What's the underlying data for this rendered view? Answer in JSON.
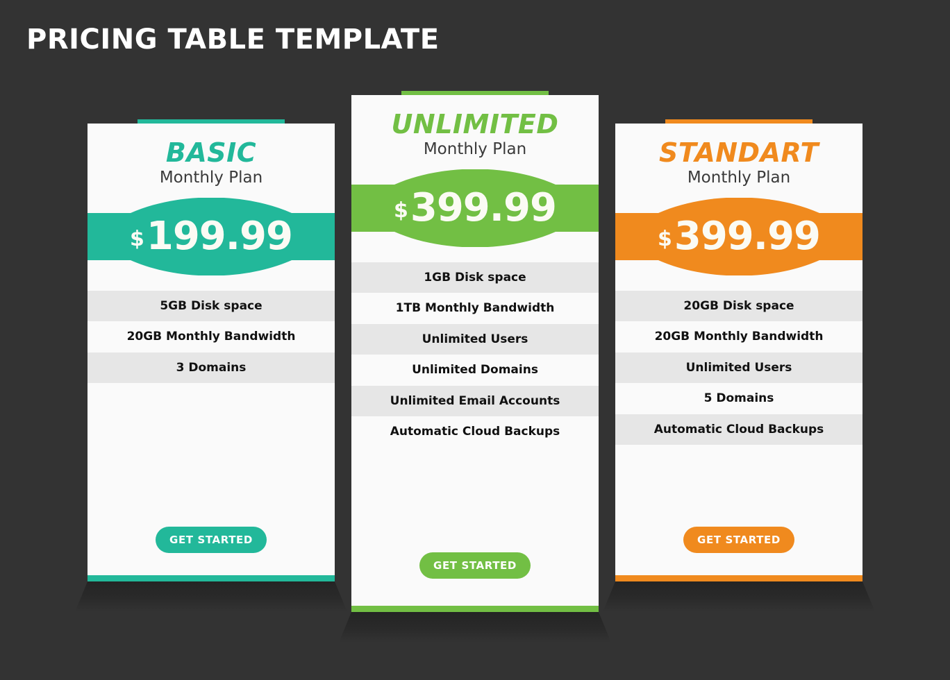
{
  "header": {
    "title": "PRICING TABLE TEMPLATE"
  },
  "colors": {
    "background": "#333333",
    "card_bg": "#fafafa",
    "row_alt_bg": "#e6e6e6",
    "basic_accent": "#22b89a",
    "unlimited_accent": "#72bf44",
    "standart_accent": "#f08a1e",
    "title_text": "#ffffff",
    "feature_text": "#111111",
    "price_text": "#fbfbf4"
  },
  "plans": [
    {
      "id": "basic",
      "name": "BASIC",
      "subtitle": "Monthly Plan",
      "currency": "$",
      "price": "199.99",
      "accent": "#22b89a",
      "featured": false,
      "features": [
        "5GB Disk space",
        "20GB Monthly Bandwidth",
        "3 Domains"
      ],
      "cta_label": "GET STARTED"
    },
    {
      "id": "unlimited",
      "name": "UNLIMITED",
      "subtitle": "Monthly Plan",
      "currency": "$",
      "price": "399.99",
      "accent": "#72bf44",
      "featured": true,
      "features": [
        "1GB Disk space",
        "1TB Monthly Bandwidth",
        "Unlimited Users",
        "Unlimited Domains",
        "Unlimited Email Accounts",
        "Automatic Cloud Backups"
      ],
      "cta_label": "GET STARTED"
    },
    {
      "id": "standart",
      "name": "STANDART",
      "subtitle": "Monthly Plan",
      "currency": "$",
      "price": "399.99",
      "accent": "#f08a1e",
      "featured": false,
      "features": [
        "20GB Disk space",
        "20GB Monthly Bandwidth",
        "Unlimited Users",
        "5 Domains",
        "Automatic Cloud Backups"
      ],
      "cta_label": "GET STARTED"
    }
  ]
}
